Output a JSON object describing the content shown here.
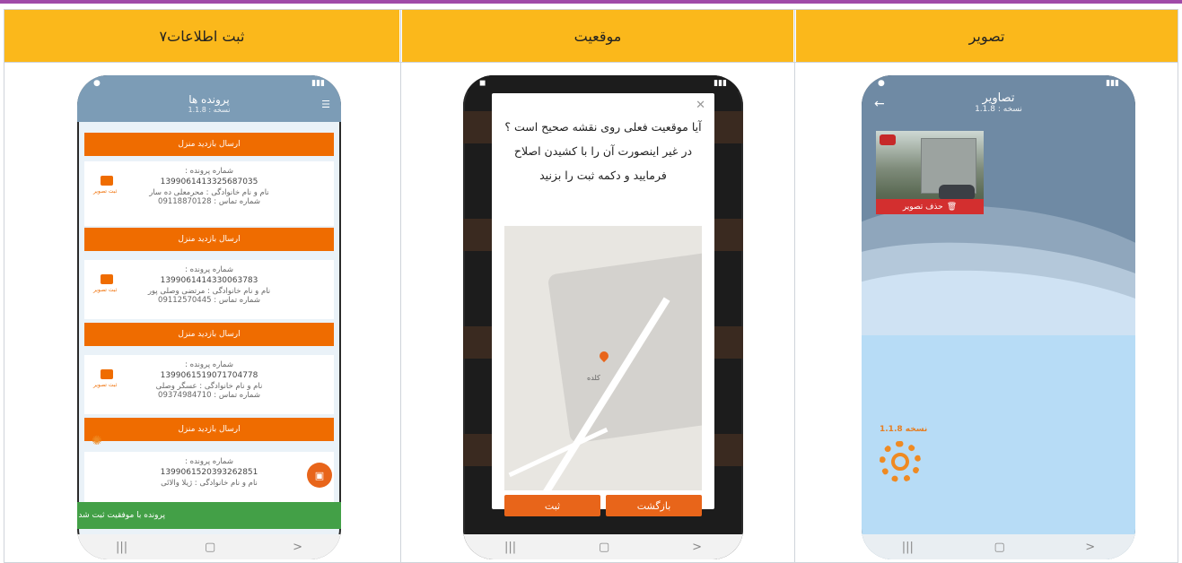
{
  "columns": [
    {
      "id": "c1",
      "heading": "ثبت اطلاعات۷"
    },
    {
      "id": "c2",
      "heading": "موقعیت"
    },
    {
      "id": "c3",
      "heading": "تصویر"
    }
  ],
  "phone_gallery": {
    "title": "تصاویر",
    "version": "نسخه : 1.1.8",
    "delete_label": "حذف تصویر",
    "footer_version": "نسخه 1.1.8",
    "icons": {
      "back": "back-arrow-icon",
      "delete": "trash-icon"
    }
  },
  "phone_location": {
    "message": "آیا موقعیت فعلی روی نقشه صحیح است ؟ در غیر اینصورت آن را با کشیدن اصلاح فرمایید و دکمه ثبت را بزنید",
    "map_place": "کلده",
    "back_label": "بازگشت",
    "submit_label": "ثبت",
    "icons": {
      "close": "close-icon",
      "pin": "map-pin-icon"
    }
  },
  "phone_records": {
    "title": "پرونده ها",
    "version": "نسخه : 1.1.8",
    "send_label": "ارسال بازدید منزل",
    "records": [
      {
        "num_label": "شماره پرونده :",
        "num": "1399061413325687035",
        "name": "نام و نام خانوادگی : محرمعلی ده سار",
        "phone": "شماره تماس : 09118870128"
      },
      {
        "num_label": "شماره پرونده :",
        "num": "1399061414330063783",
        "name": "نام و نام خانوادگی : مرتضی وصلی پور",
        "phone": "شماره تماس : 09112570445"
      },
      {
        "num_label": "شماره پرونده :",
        "num": "1399061519071704778",
        "name": "نام و نام خانوادگی : عسگر وصلی",
        "phone": "شماره تماس : 09374984710"
      },
      {
        "num_label": "شماره پرونده :",
        "num": "1399061520393262851",
        "name": "نام و نام خانوادگی : ژیلا والائی",
        "phone": ""
      }
    ],
    "camera_label": "ثبت تصویر",
    "toast": "پرونده با موفقیت ثبت شد"
  }
}
